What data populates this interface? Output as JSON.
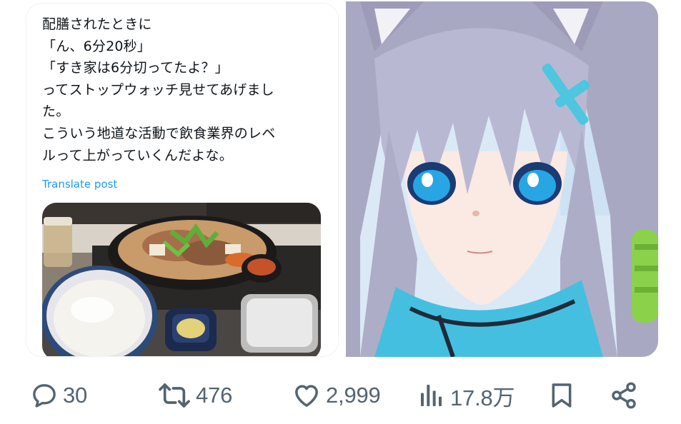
{
  "post": {
    "quote": {
      "text_lines": [
        "配膳されたときに",
        "「ん、6分20秒」",
        "「すき家は6分切ってたよ？」",
        "ってストップウォッチ見せてあげまし",
        "た。",
        "こういう地道な活動で飲食業界のレベ",
        "ルって上がっていくんだよな。"
      ],
      "translate_label": "Translate post"
    },
    "actions": {
      "replies": {
        "icon": "reply-icon",
        "count": "30"
      },
      "reposts": {
        "icon": "repost-icon",
        "count": "476"
      },
      "likes": {
        "icon": "heart-icon",
        "count": "2,999"
      },
      "views": {
        "icon": "views-chart-icon",
        "count": "17.8万"
      },
      "bookmark": {
        "icon": "bookmark-icon"
      },
      "share": {
        "icon": "share-icon"
      }
    }
  },
  "colors": {
    "text": "#0f1419",
    "secondary": "#536471",
    "link": "#1d9bf0",
    "border": "#eef0f2"
  }
}
